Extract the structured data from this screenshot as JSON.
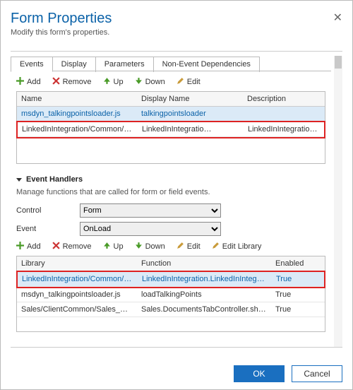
{
  "header": {
    "title": "Form Properties",
    "subtitle": "Modify this form's properties.",
    "close": "✕"
  },
  "tabs": [
    "Events",
    "Display",
    "Parameters",
    "Non-Event Dependencies"
  ],
  "toolbar1": {
    "add": "Add",
    "remove": "Remove",
    "up": "Up",
    "down": "Down",
    "edit": "Edit"
  },
  "grid1": {
    "headers": {
      "name": "Name",
      "display": "Display Name",
      "desc": "Description"
    },
    "rows": [
      {
        "name": "msdyn_talkingpointsloader.js",
        "display": "talkingpointsloader",
        "desc": ""
      },
      {
        "name": "LinkedInIntegration/Common/msdyn_L…",
        "display": "LinkedInIntegratio…",
        "desc": "LinkedInIntegratio…"
      }
    ]
  },
  "handlers": {
    "heading": "Event Handlers",
    "helper": "Manage functions that are called for form or field events.",
    "control_label": "Control",
    "control_value": "Form",
    "event_label": "Event",
    "event_value": "OnLoad"
  },
  "toolbar2": {
    "add": "Add",
    "remove": "Remove",
    "up": "Up",
    "down": "Down",
    "edit": "Edit",
    "editlib": "Edit Library"
  },
  "grid2": {
    "headers": {
      "lib": "Library",
      "func": "Function",
      "enabled": "Enabled"
    },
    "rows": [
      {
        "lib": "LinkedInIntegration/Common/msdyn_L…",
        "func": "LinkedInIntegration.LinkedInIntegration…",
        "enabled": "True"
      },
      {
        "lib": "msdyn_talkingpointsloader.js",
        "func": "loadTalkingPoints",
        "enabled": "True"
      },
      {
        "lib": "Sales/ClientCommon/Sales_ClientCom…",
        "func": "Sales.DocumentsTabController.shouldS…",
        "enabled": "True"
      }
    ]
  },
  "footer": {
    "ok": "OK",
    "cancel": "Cancel"
  }
}
